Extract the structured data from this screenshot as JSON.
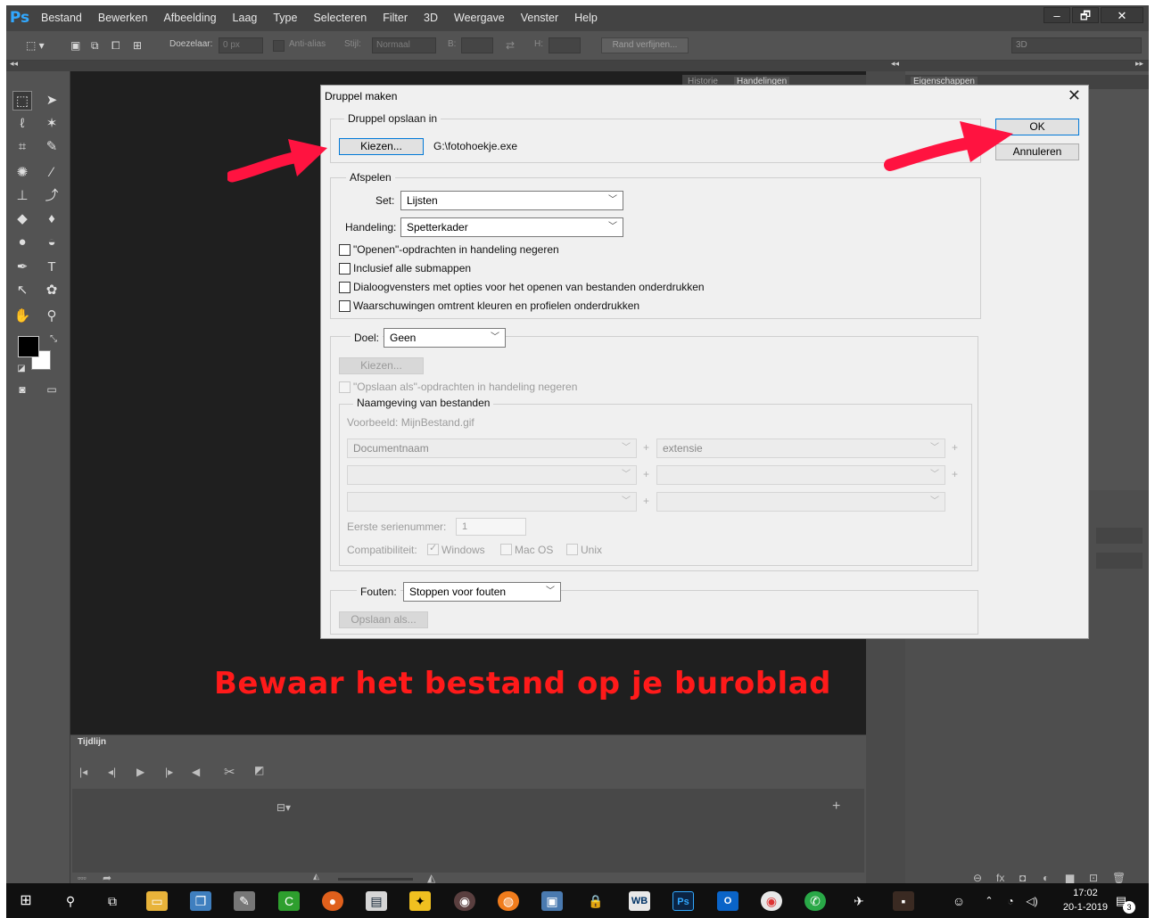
{
  "app": {
    "logo": "Ps",
    "menu": [
      "Bestand",
      "Bewerken",
      "Afbeelding",
      "Laag",
      "Type",
      "Selecteren",
      "Filter",
      "3D",
      "Weergave",
      "Venster",
      "Help"
    ],
    "window_controls": [
      "–",
      "🗗",
      "✕"
    ]
  },
  "options_bar": {
    "feather_label": "Doezelaar:",
    "feather_value": "0 px",
    "antialias_label": "Anti-alias",
    "style_label": "Stijl:",
    "style_value": "Normaal",
    "width_label": "B:",
    "height_label": "H:",
    "refine_button": "Rand verfijnen...",
    "workspace_value": "3D"
  },
  "panels": {
    "history_tab": "Historie",
    "actions_tab": "Handelingen",
    "properties_tab": "Eigenschappen"
  },
  "timeline": {
    "title": "Tijdlijn"
  },
  "annotation": {
    "text": "Bewaar het bestand op je buroblad"
  },
  "dialog": {
    "title": "Druppel maken",
    "close": "✕",
    "ok_button": "OK",
    "cancel_button": "Annuleren",
    "save_group": {
      "label": "Druppel opslaan in",
      "choose_button": "Kiezen...",
      "path": "G:\\fotohoekje.exe"
    },
    "play_group": {
      "label": "Afspelen",
      "set_label": "Set:",
      "set_value": "Lijsten",
      "action_label": "Handeling:",
      "action_value": "Spetterkader",
      "checkboxes": [
        "\"Openen\"-opdrachten in handeling negeren",
        "Inclusief alle submappen",
        "Dialoogvensters met opties voor het openen van bestanden onderdrukken",
        "Waarschuwingen omtrent kleuren en profielen onderdrukken"
      ]
    },
    "target_group": {
      "label": "Doel:",
      "value": "Geen",
      "choose_button": "Kiezen...",
      "ignore_saveas": "\"Opslaan als\"-opdrachten in handeling negeren",
      "naming": {
        "label": "Naamgeving van bestanden",
        "example": "Voorbeeld: MijnBestand.gif",
        "row1_left": "Documentnaam",
        "row1_right": "extensie",
        "plus": "+",
        "serial_label": "Eerste serienummer:",
        "serial_value": "1",
        "compat_label": "Compatibiliteit:",
        "compat_options": [
          "Windows",
          "Mac OS",
          "Unix"
        ]
      }
    },
    "errors_group": {
      "label": "Fouten:",
      "value": "Stoppen voor fouten",
      "saveas_button": "Opslaan als..."
    }
  },
  "taskbar": {
    "time": "17:02",
    "date": "20-1-2019",
    "notif_count": "3"
  }
}
